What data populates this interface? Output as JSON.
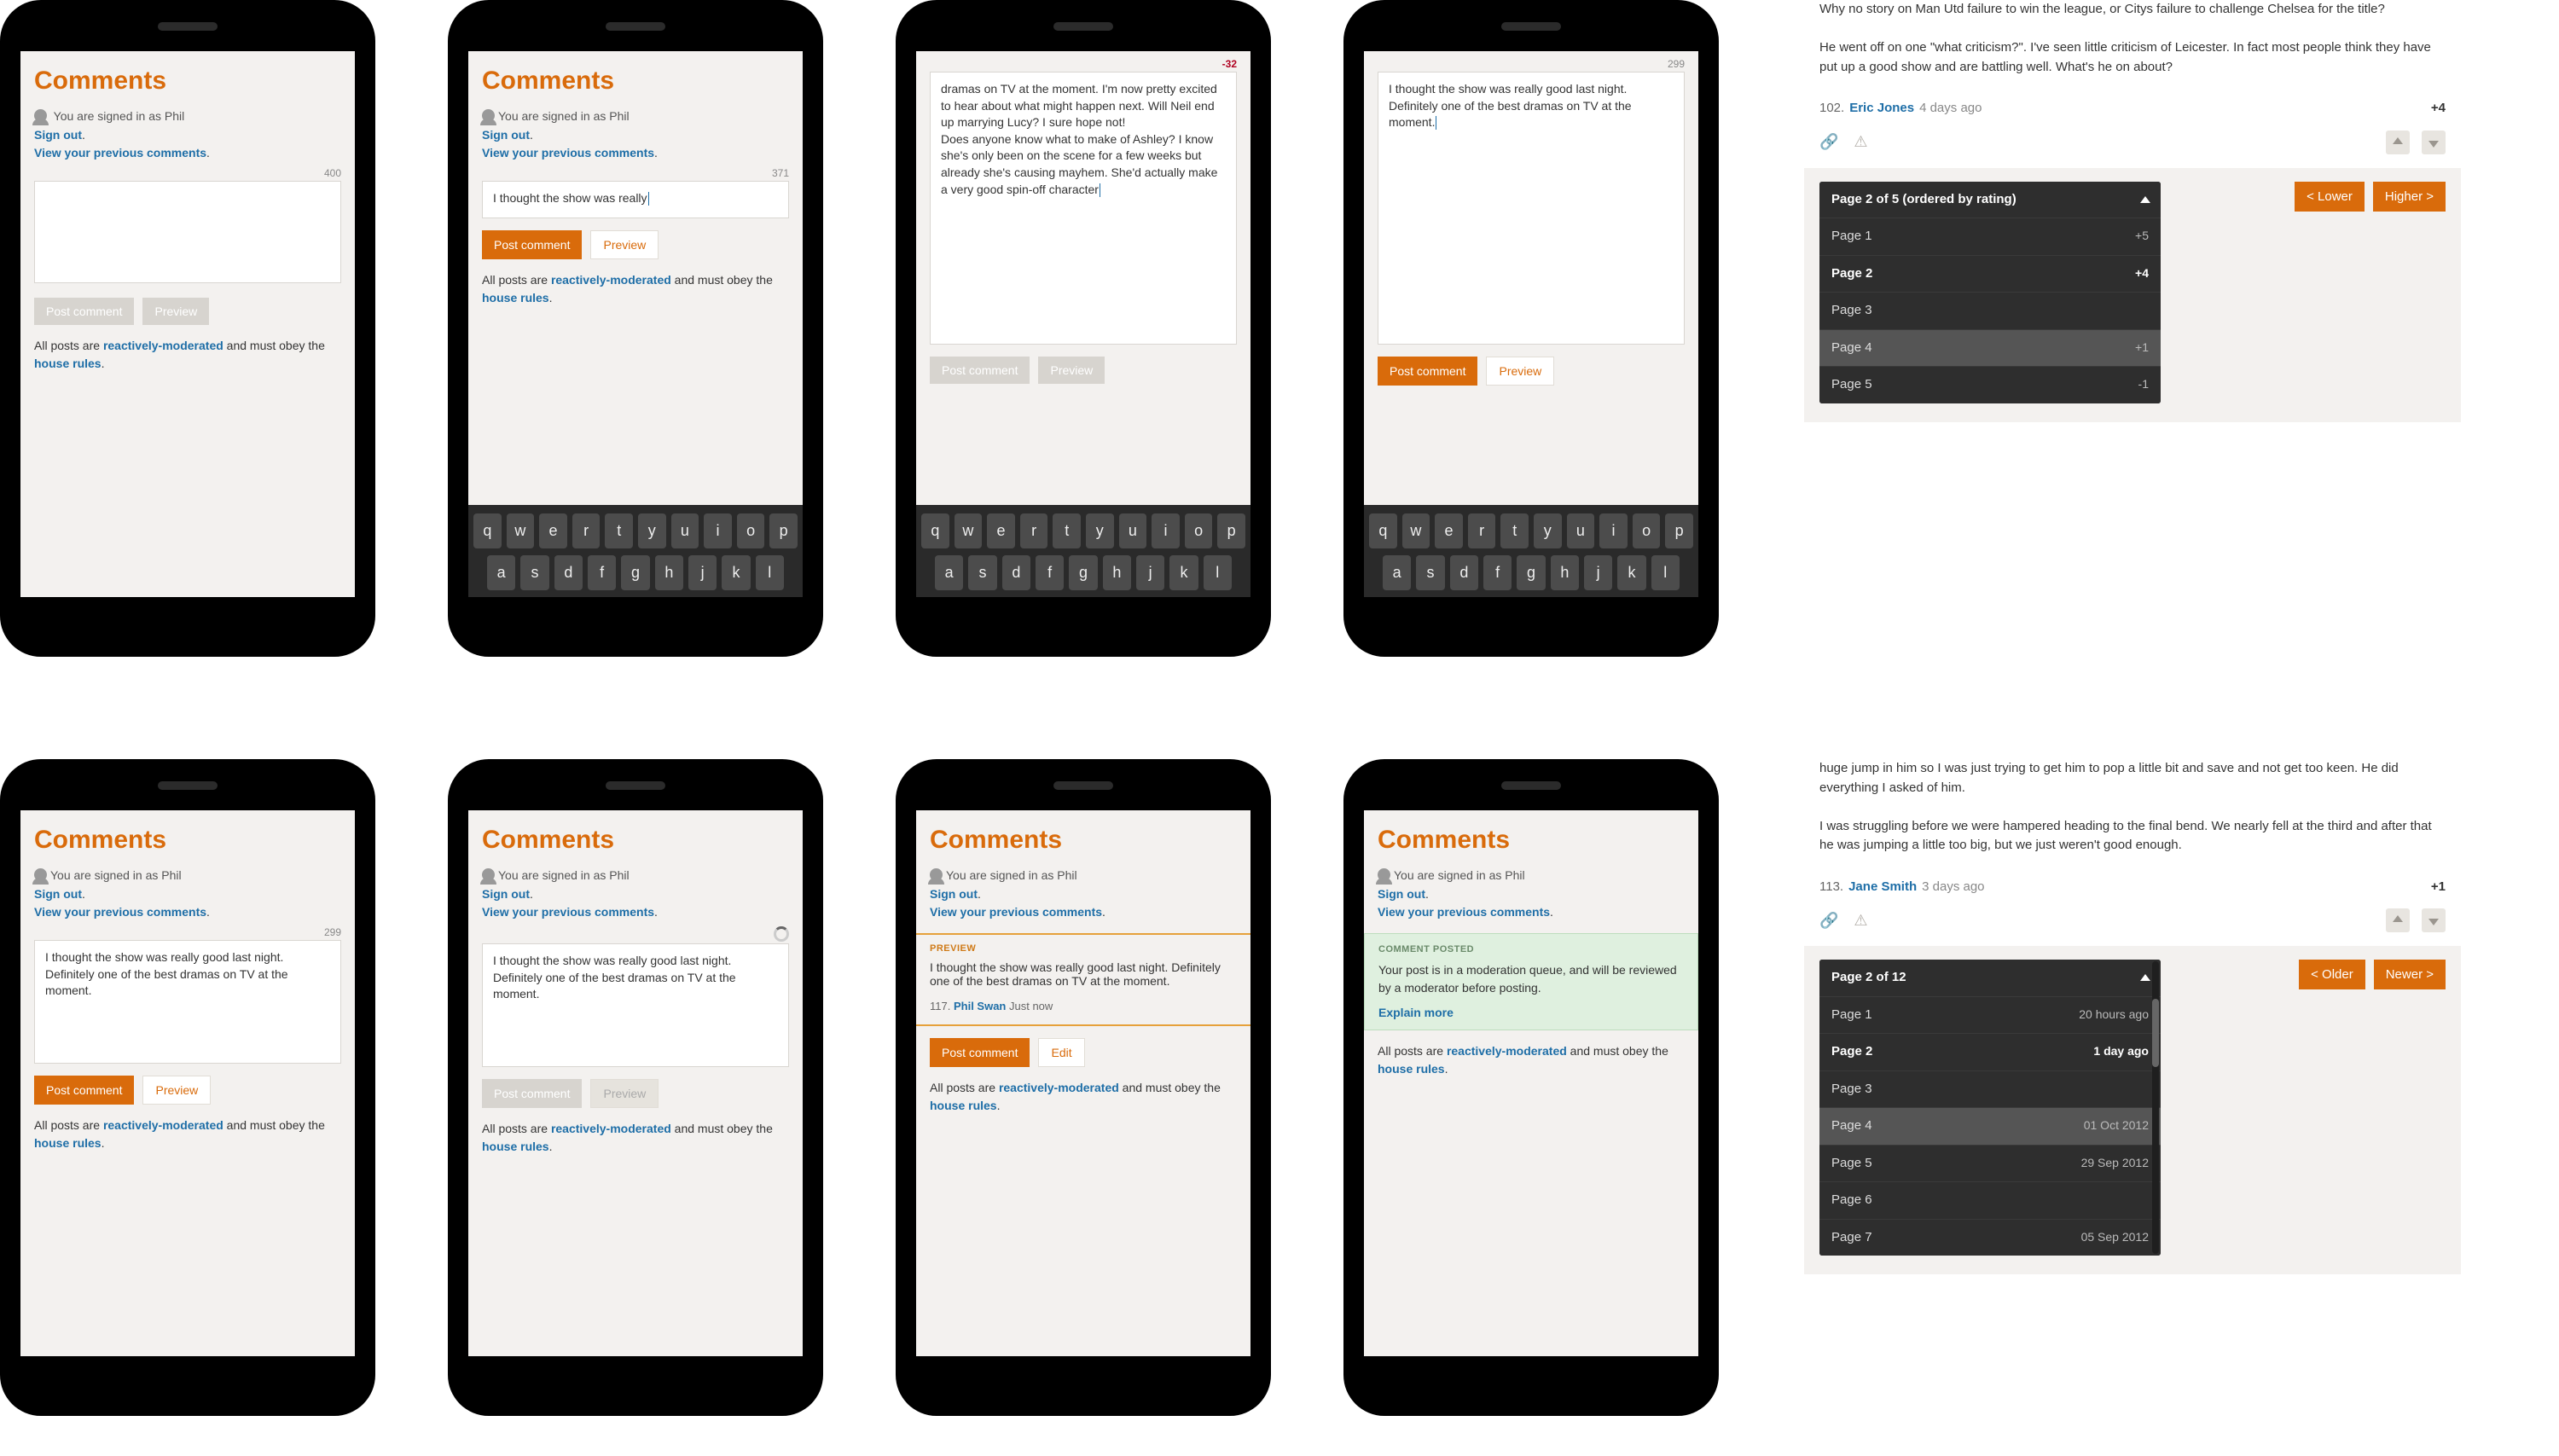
{
  "common": {
    "comments_title": "Comments",
    "signed_in_prefix": "You are signed in as",
    "signed_in_name": "Phil",
    "sign_out": "Sign out",
    "view_prev": "View your previous comments",
    "post_btn": "Post comment",
    "preview_btn": "Preview",
    "edit_btn": "Edit",
    "footnote_a": "All posts are ",
    "footnote_link": "reactively-moderated",
    "footnote_b": " and must obey the ",
    "footnote_link2": "house rules",
    "period": "."
  },
  "phones": {
    "p1": {
      "counter": "400",
      "text": ""
    },
    "p2": {
      "counter": "371",
      "text": "I thought the show was really"
    },
    "p3": {
      "counter": "-32",
      "text": "dramas on TV at the moment. I'm now pretty excited to hear about what might happen next. Will Neil end up marrying Lucy? I sure hope not!\nDoes anyone know what to make of Ashley? I know she's only been on the scene for a few weeks but already she's causing mayhem. She'd actually make a very good spin-off character"
    },
    "p4": {
      "counter": "299",
      "text": "I thought the show was really good last night. Definitely one of the best dramas on TV at the moment."
    },
    "p5": {
      "counter": "299",
      "text": "I thought the show was really good last night. Definitely one of the best dramas on TV at the moment."
    },
    "p6": {
      "text": "I thought the show was really good last night. Definitely one of the best dramas on TV at the moment."
    },
    "p7": {
      "preview_label": "PREVIEW",
      "text": "I thought the show was really good last night. Definitely one of the best dramas on TV at the moment.",
      "byline_num": "117.",
      "byline_author": "Phil Swan",
      "byline_time": "Just now"
    },
    "p8": {
      "posted_label": "COMMENT POSTED",
      "text": "Your post is in a moderation queue, and will be reviewed by a moderator before posting.",
      "explain": "Explain more"
    }
  },
  "keyboard": {
    "row1": [
      "q",
      "w",
      "e",
      "r",
      "t",
      "y",
      "u",
      "i",
      "o",
      "p"
    ],
    "row2": [
      "a",
      "s",
      "d",
      "f",
      "g",
      "h",
      "j",
      "k",
      "l"
    ]
  },
  "desk1": {
    "para1": "Why no story on Man Utd failure to win the league, or Citys failure to challenge Chelsea for the title?",
    "para2": "He went off on one \"what criticism?\". I've seen little criticism of Leicester. In fact most people think they have put up a good show and are battling well. What's he on about?",
    "num": "102.",
    "author": "Eric Jones",
    "time": "4 days ago",
    "score": "+4",
    "pager_head": "Page 2 of 5 (ordered by rating)",
    "lower": "< Lower",
    "higher": "Higher >",
    "rows": [
      {
        "label": "Page 1",
        "meta": "+5"
      },
      {
        "label": "Page 2",
        "meta": "+4",
        "active": true
      },
      {
        "label": "Page 3",
        "meta": ""
      },
      {
        "label": "Page 4",
        "meta": "+1",
        "hover": true
      },
      {
        "label": "Page 5",
        "meta": "-1"
      }
    ]
  },
  "desk2": {
    "para1": "huge jump in him so I was just trying to get him to pop a little bit and save and not get too keen. He did everything I asked of him.",
    "para2": "I was struggling before we were hampered heading to the final bend. We nearly fell at the third and after that he was jumping a little too big, but we just weren't good enough.",
    "num": "113.",
    "author": "Jane Smith",
    "time": "3 days ago",
    "score": "+1",
    "pager_head": "Page 2 of 12",
    "older": "< Older",
    "newer": "Newer >",
    "rows": [
      {
        "label": "Page 1",
        "meta": "20 hours ago"
      },
      {
        "label": "Page 2",
        "meta": "1 day ago",
        "active": true
      },
      {
        "label": "Page 3",
        "meta": ""
      },
      {
        "label": "Page 4",
        "meta": "01 Oct 2012",
        "hover": true
      },
      {
        "label": "Page 5",
        "meta": "29 Sep 2012"
      },
      {
        "label": "Page 6",
        "meta": ""
      },
      {
        "label": "Page 7",
        "meta": "05 Sep 2012"
      }
    ]
  }
}
